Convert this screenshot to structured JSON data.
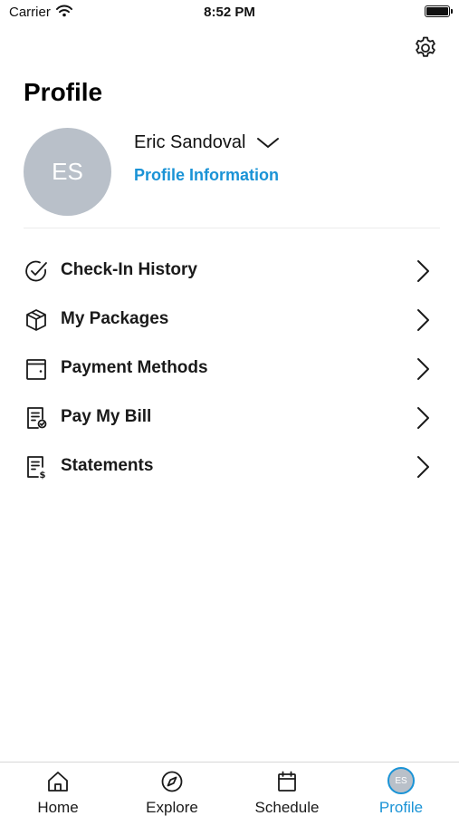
{
  "status_bar": {
    "carrier": "Carrier",
    "time": "8:52 PM",
    "wifi_icon": "wifi-icon",
    "battery_icon": "battery-full-icon"
  },
  "header": {
    "settings_icon": "gear-icon",
    "title": "Profile"
  },
  "user": {
    "initials": "ES",
    "name": "Eric Sandoval",
    "switch_icon": "chevron-down-icon",
    "profile_link": "Profile Information"
  },
  "menu": {
    "items": [
      {
        "label": "Check-In History",
        "icon": "check-circle-icon"
      },
      {
        "label": "My Packages",
        "icon": "package-icon"
      },
      {
        "label": "Payment Methods",
        "icon": "wallet-icon"
      },
      {
        "label": "Pay My Bill",
        "icon": "bill-check-icon"
      },
      {
        "label": "Statements",
        "icon": "statement-dollar-icon"
      }
    ]
  },
  "tab_bar": {
    "active": "Profile",
    "tabs": [
      {
        "label": "Home",
        "icon": "home-icon"
      },
      {
        "label": "Explore",
        "icon": "compass-icon"
      },
      {
        "label": "Schedule",
        "icon": "calendar-icon"
      },
      {
        "label": "Profile",
        "icon": "avatar",
        "initials": "ES"
      }
    ]
  },
  "colors": {
    "accent": "#1a93d6",
    "avatar_bg": "#b9c0c9",
    "divider": "#ececec",
    "text": "#111111"
  }
}
